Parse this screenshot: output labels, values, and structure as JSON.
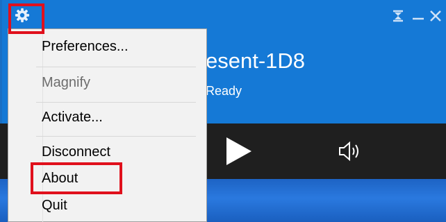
{
  "colors": {
    "window_blue": "#1579d6",
    "control_bar": "#1f1f1f",
    "menu_background": "#f2f2f2",
    "highlight_red": "#e0101c",
    "disabled_text": "#6d6d6d"
  },
  "titlebar": {
    "settings_icon": "gear-icon",
    "pin_icon": "pin-icon",
    "minimize_icon": "minimize-icon",
    "close_icon": "close-icon"
  },
  "device": {
    "name": "esent-1D8",
    "status": "Ready"
  },
  "player": {
    "play_icon": "play-icon",
    "volume_icon": "speaker-icon"
  },
  "menu": {
    "items": [
      {
        "label": "Preferences...",
        "enabled": true
      },
      {
        "label": "Magnify",
        "enabled": false
      },
      {
        "label": "Activate...",
        "enabled": true
      },
      {
        "label": "Disconnect",
        "enabled": true
      },
      {
        "label": "About",
        "enabled": true
      },
      {
        "label": "Quit",
        "enabled": true
      }
    ]
  }
}
